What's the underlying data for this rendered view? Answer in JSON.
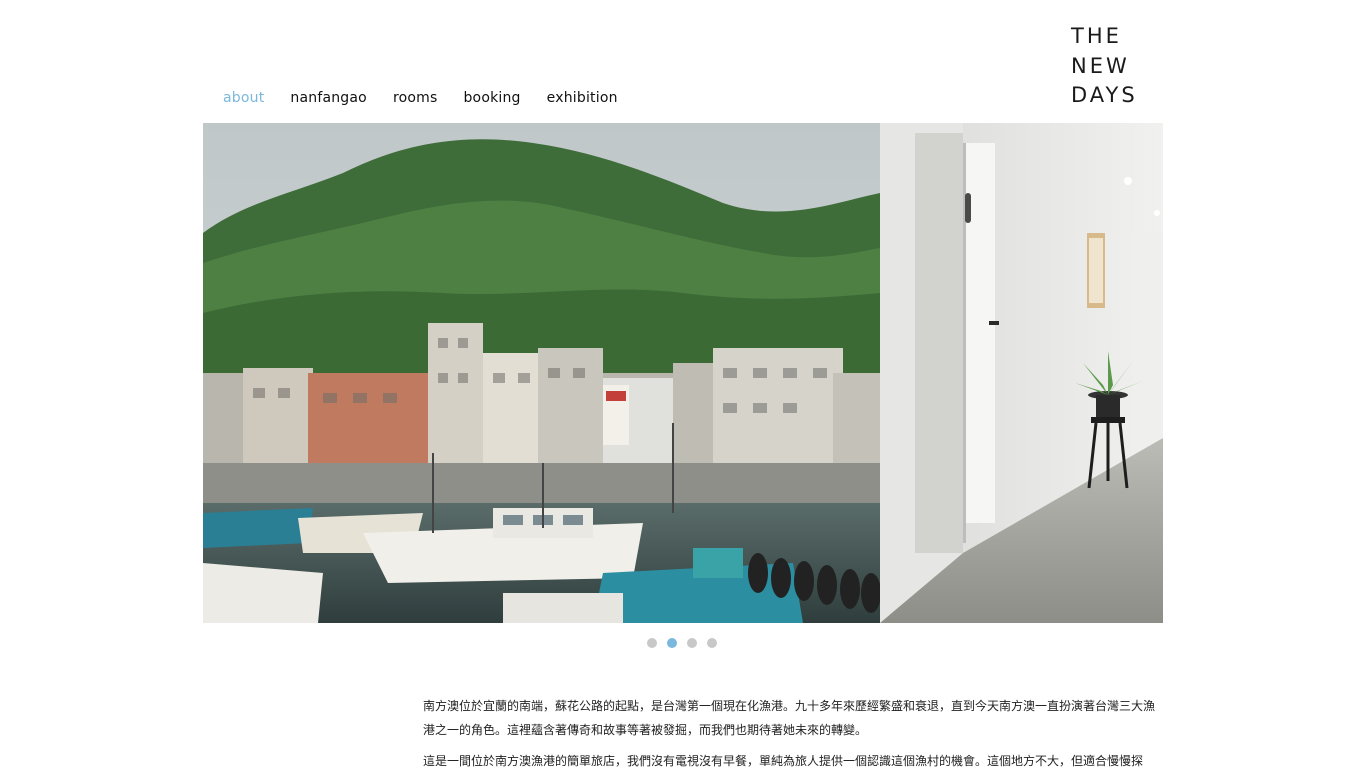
{
  "brand": {
    "logo_lines": [
      "THE",
      "NEW",
      "DAYS"
    ]
  },
  "nav": {
    "items": [
      {
        "label": "about",
        "active": true
      },
      {
        "label": "nanfangao",
        "active": false
      },
      {
        "label": "rooms",
        "active": false
      },
      {
        "label": "booking",
        "active": false
      },
      {
        "label": "exhibition",
        "active": false
      }
    ]
  },
  "carousel": {
    "slide_count": 4,
    "active_index": 1
  },
  "colors": {
    "accent": "#7ab8dd",
    "dot_inactive": "#c8c8c8",
    "text": "#222222"
  },
  "content": {
    "paragraphs": [
      "南方澳位於宜蘭的南端，蘇花公路的起點，是台灣第一個現在化漁港。九十多年來歷經繁盛和衰退，直到今天南方澳一直扮演著台灣三大漁港之一的角色。這裡蘊含著傳奇和故事等著被發掘，而我們也期待著她未來的轉變。",
      "這是一間位於南方澳漁港的簡單旅店，我們沒有電視沒有早餐，單純為旅人提供一個認識這個漁村的機會。這個地方不大，但適合慢慢探"
    ]
  }
}
